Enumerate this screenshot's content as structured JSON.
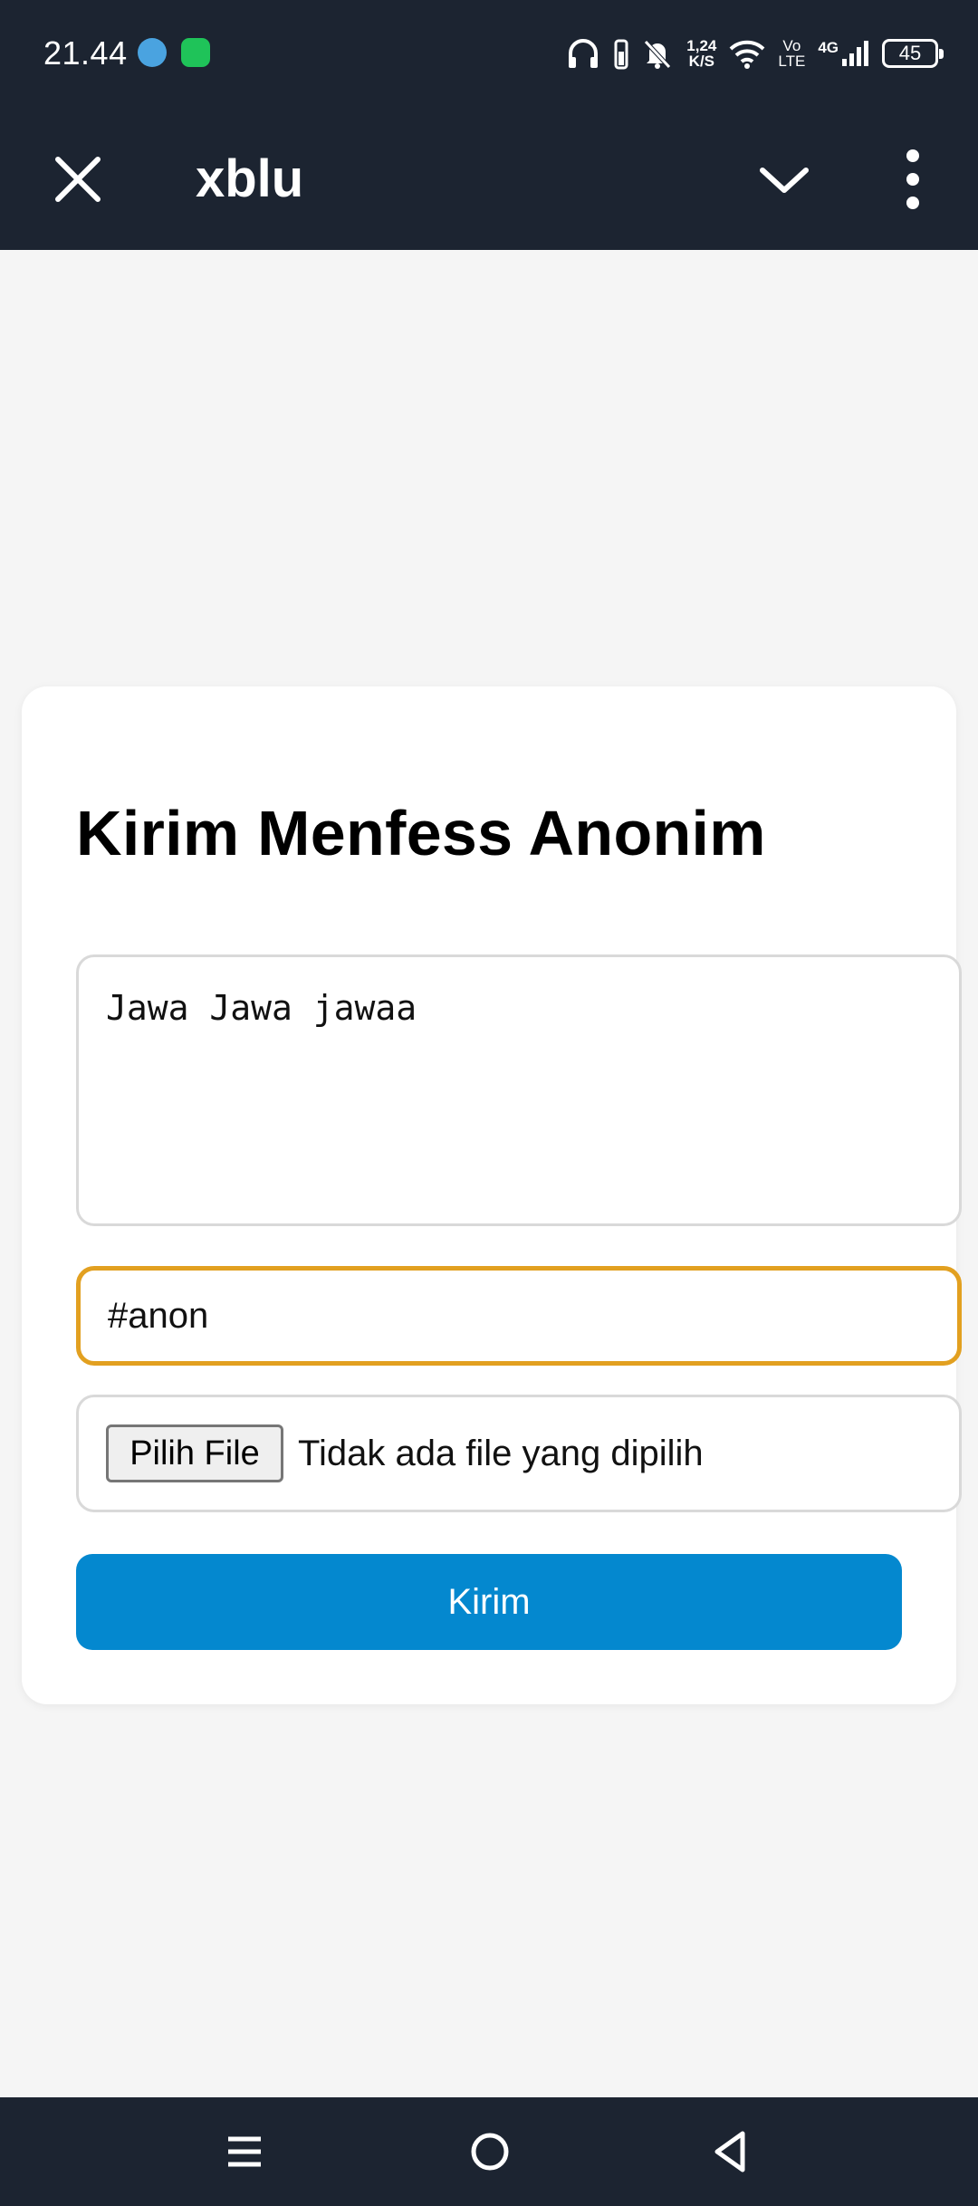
{
  "status_bar": {
    "time": "21.44",
    "network_speed_value": "1,24",
    "network_speed_unit": "K/S",
    "volte_line1": "Vo",
    "volte_line2": "LTE",
    "network_type": "4G",
    "battery_level": "45",
    "icons": [
      "telegram-icon",
      "line-icon",
      "headphones-icon",
      "battery-saver-icon",
      "bell-muted-icon",
      "wifi-icon",
      "signal-icon",
      "battery-icon"
    ]
  },
  "app_bar": {
    "title": "xblu",
    "icons": [
      "close-icon",
      "chevron-down-icon",
      "more-vertical-icon"
    ]
  },
  "form": {
    "title": "Kirim Menfess Anonim",
    "message_value": "Jawa Jawa jawaa",
    "tag_value": "#anon",
    "file_button_label": "Pilih File",
    "file_status": "Tidak ada file yang dipilih",
    "submit_label": "Kirim"
  },
  "colors": {
    "header_bg": "#1c2431",
    "page_bg": "#f5f5f5",
    "focus_border": "#e2a020",
    "submit_bg": "#0488cf"
  },
  "nav_bar": {
    "icons": [
      "recent-apps-icon",
      "home-icon",
      "back-icon"
    ]
  }
}
